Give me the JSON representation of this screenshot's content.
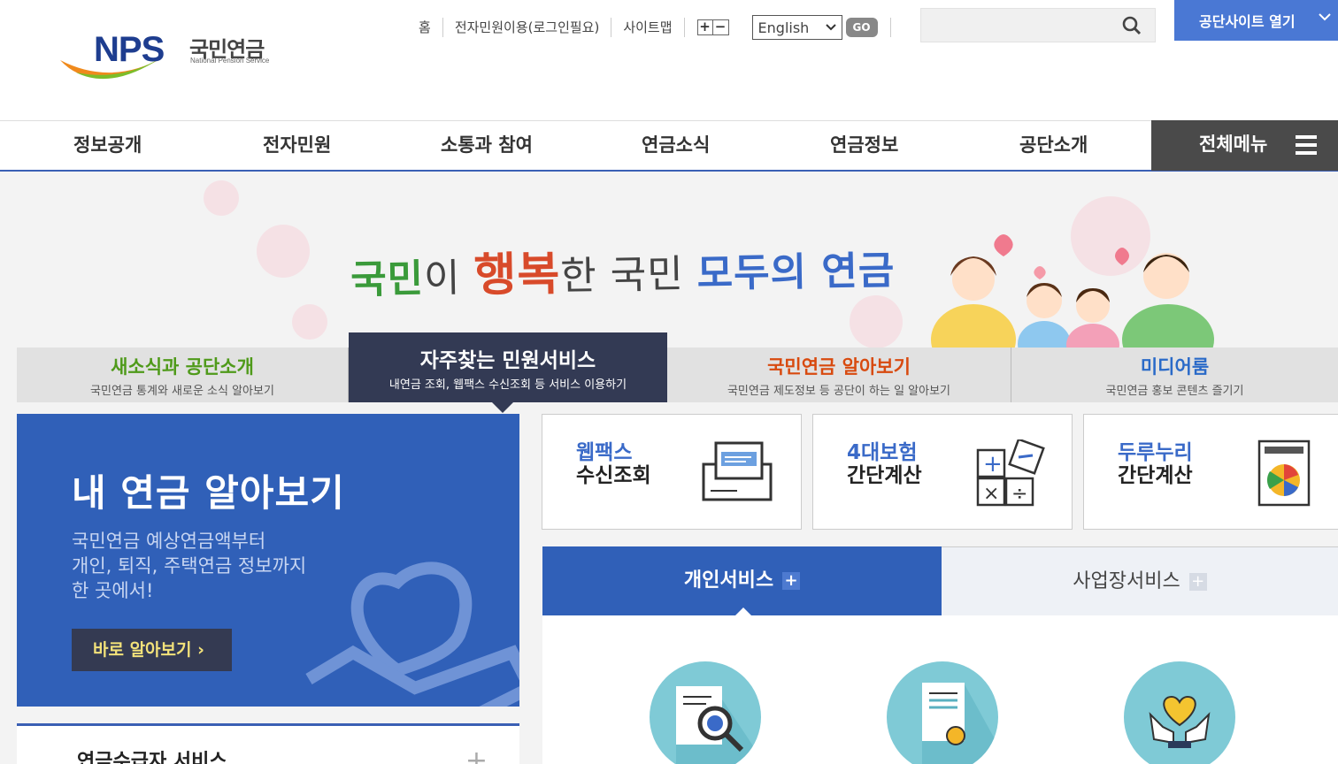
{
  "logo": {
    "abbr": "NPS",
    "name_ko": "국민연금",
    "name_en": "National Pension Service"
  },
  "util": {
    "links": [
      "홈",
      "전자민원이용(로그인필요)",
      "사이트맵"
    ],
    "font_plus": "+",
    "font_minus": "−",
    "language": "English",
    "go": "GO"
  },
  "search": {
    "placeholder": "",
    "icon": "search-icon"
  },
  "open_site": {
    "label": "공단사이트 열기"
  },
  "gnb": {
    "items": [
      "정보공개",
      "전자민원",
      "소통과 참여",
      "연금소식",
      "연금정보",
      "공단소개"
    ],
    "all_menu": "전체메뉴"
  },
  "hero": {
    "slogan": {
      "p1": "국민",
      "p2": "이 ",
      "p3": "행복",
      "p4": "한 국민 ",
      "p5": "모두의 연금"
    }
  },
  "tabs": [
    {
      "title": "새소식과 공단소개",
      "sub": "국민연금 통계와 새로운 소식 알아보기",
      "color": "#4f9a1a"
    },
    {
      "title": "자주찾는 민원서비스",
      "sub": "내연금 조회, 웹팩스 수신조회 등 서비스 이용하기",
      "color": "#ffffff"
    },
    {
      "title": "국민연금 알아보기",
      "sub": "국민연금 제도정보 등 공단이 하는 일 알아보기",
      "color": "#d84a0f"
    },
    {
      "title": "미디어룸",
      "sub": "국민연금 홍보 콘텐츠 즐기기",
      "color": "#2a6ac8"
    }
  ],
  "my_pension": {
    "title": "내 연금 알아보기",
    "desc": [
      "국민연금 예상연금액부터",
      "개인, 퇴직, 주택연금 정보까지",
      "한 곳에서!"
    ],
    "button": "바로 알아보기 ›"
  },
  "recipient": {
    "title": "연금수급자 서비스",
    "plus": "+"
  },
  "service_boxes": [
    {
      "line1": "웹팩스",
      "line2": "수신조회",
      "icon": "fax-icon"
    },
    {
      "line1": "4대보험",
      "line2": "간단계산",
      "icon": "calculator-icon"
    },
    {
      "line1": "두루누리",
      "line2": "간단계산",
      "icon": "durunuri-icon"
    }
  ],
  "service_tabs": {
    "personal": "개인서비스",
    "business": "사업장서비스",
    "plus": "+"
  },
  "colors": {
    "primary": "#3060b8",
    "dark": "#333a54",
    "accent": "#4a78d4"
  }
}
